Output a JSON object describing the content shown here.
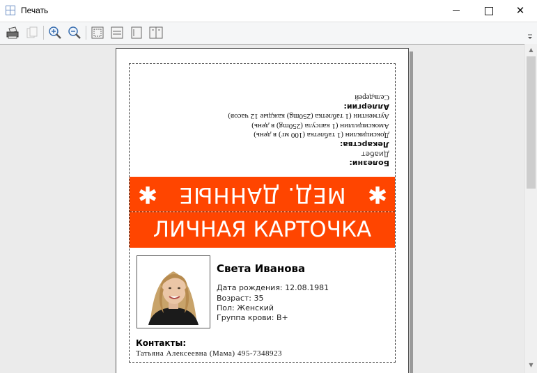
{
  "window": {
    "title": "Печать"
  },
  "toolbar": {
    "buttons": [
      "print-icon",
      "copy-icon",
      "zoom-in-icon",
      "zoom-out-icon",
      "fit-page-icon",
      "fit-width-icon",
      "single-page-icon",
      "two-page-icon"
    ]
  },
  "card": {
    "back": {
      "banner": "МЕД. ДАННЫЕ",
      "diseases_label": "Болезни:",
      "diseases": [
        "Диабет"
      ],
      "medicines_label": "Лекарства:",
      "medicines": [
        "Доксициклин (1 таблетка (100 мг) в день)",
        "Амоксициллин (1 капсула (250mg) в день)",
        "Аугментин (1 таблетка (250mg) каждые 12 часов)"
      ],
      "allergies_label": "Аллергии:",
      "allergies": [
        "Сельдерей"
      ]
    },
    "front": {
      "banner": "ЛИЧНАЯ КАРТОЧКА",
      "name": "Света Иванова",
      "dob": "Дата рождения: 12.08.1981",
      "age": "Возраст: 35",
      "sex": "Пол: Женский",
      "blood": "Группа крови: B+",
      "contacts_label": "Контакты:",
      "contact": "Татьяна Алексеевна (Мама) 495-7348923"
    }
  },
  "colors": {
    "banner": "#ff4500"
  }
}
